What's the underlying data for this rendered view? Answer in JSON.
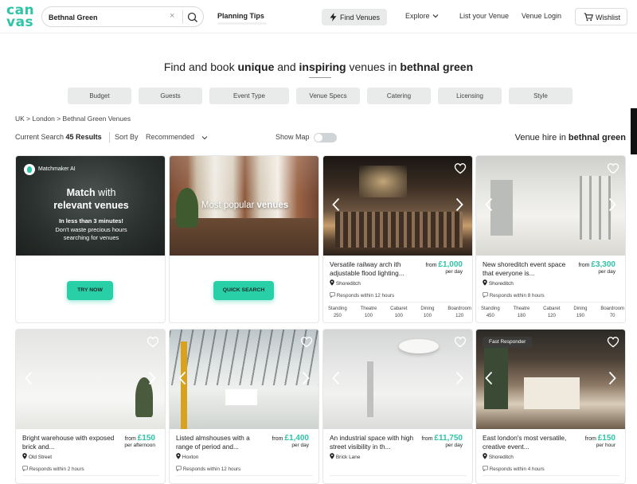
{
  "header": {
    "logo_top": "can",
    "logo_bottom": "vas",
    "search_value": "Bethnal Green",
    "clear_label": "×",
    "nav": {
      "planning_tips": "Planning Tips",
      "find_venues": "Find Venues",
      "explore": "Explore",
      "list_venue": "List your Venue",
      "venue_login": "Venue Login",
      "wishlist": "Wishlist"
    }
  },
  "hero": {
    "t1": "Find and book ",
    "t2": "unique",
    "t3": " and ",
    "t4": "inspiring",
    "t5": " venues in ",
    "t6": "bethnal green"
  },
  "filters": [
    "Budget",
    "Guests",
    "Event Type",
    "Venue Specs",
    "Catering",
    "Licensing",
    "Style"
  ],
  "breadcrumb": "UK > London > Bethnal Green Venues",
  "results": {
    "current_search": "Current Search",
    "count": "45 Results",
    "sort_by": "Sort By",
    "sort_value": "Recommended",
    "show_map": "Show Map",
    "hire_prefix": "Venue hire in ",
    "hire_place": "bethnal green"
  },
  "promo": {
    "ai_badge": "Matchmaker AI",
    "ai_h1a": "Match",
    "ai_h1b": " with",
    "ai_h2": "relevant venues",
    "ai_sub1": "In less than 3 minutes!",
    "ai_sub2": "Don't waste precious hours",
    "ai_sub3": "searching for venues",
    "ai_btn": "TRY NOW",
    "pop_a": "Most popular ",
    "pop_b": "venues",
    "pop_btn": "QUICK SEARCH"
  },
  "cap_labels": [
    "Standing",
    "Theatre",
    "Cabaret",
    "Dining",
    "Boardroom"
  ],
  "venues": [
    {
      "title": "Versatile railway arch ith adjustable flood lighting...",
      "from": "from ",
      "price": "£1,000",
      "per": "per day",
      "location": "Shoreditch",
      "responds": "Responds within 12 hours",
      "caps": [
        "250",
        "100",
        "100",
        "100",
        "120"
      ]
    },
    {
      "title": "New shoreditch event space that everyone is...",
      "from": "from ",
      "price": "£3,300",
      "per": "per day",
      "location": "Shoreditch",
      "responds": "Responds within 8 hours",
      "caps": [
        "450",
        "180",
        "120",
        "190",
        "70"
      ]
    },
    {
      "title": "Bright warehouse with exposed brick and...",
      "from": "from ",
      "price": "£150",
      "per": "per afternoon",
      "location": "Old Street",
      "responds": "Responds within 2 hours"
    },
    {
      "title": "Listed almshouses with a range of period and...",
      "from": "from ",
      "price": "£1,400",
      "per": "per day",
      "location": "Hoxton",
      "responds": "Responds within 12 hours"
    },
    {
      "title": "An industrial space with high street visibility in th...",
      "from": "from ",
      "price": "£11,750",
      "per": "per day",
      "location": "Brick Lane",
      "responds": ""
    },
    {
      "title": "East london's most versatile, creative event...",
      "from": "from ",
      "price": "£150",
      "per": "per hour",
      "location": "Shoreditch",
      "responds": "Responds within 4 hours",
      "badge": "Fast Responder"
    }
  ],
  "colors": {
    "accent": "#2ec4a6",
    "button": "#29cfa6",
    "filter_bg": "#e9eaea"
  }
}
